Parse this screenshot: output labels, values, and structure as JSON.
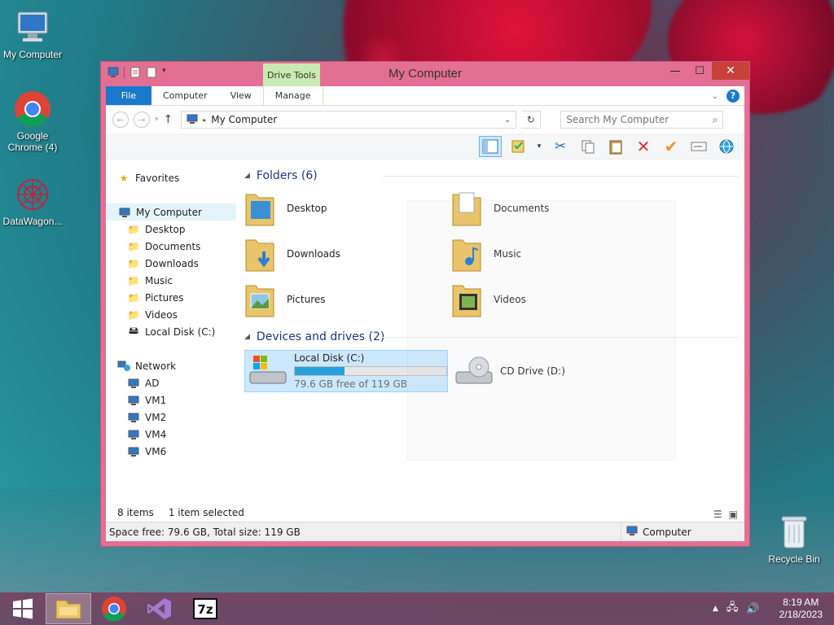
{
  "desktop": {
    "icons": [
      {
        "label": "My Computer"
      },
      {
        "label": "Google Chrome (4)"
      },
      {
        "label": "DataWagon..."
      },
      {
        "label": "Recycle Bin"
      }
    ]
  },
  "window": {
    "title": "My Computer",
    "context_tab": "Drive Tools",
    "ribbon_tabs": [
      "File",
      "Computer",
      "View",
      "Manage"
    ],
    "controls": {
      "minimize": "—",
      "maximize": "☐",
      "close": "✕"
    }
  },
  "address": {
    "path": "My Computer",
    "search_placeholder": "Search My Computer"
  },
  "navpane": {
    "favorites": "Favorites",
    "computer": "My Computer",
    "computer_children": [
      "Desktop",
      "Documents",
      "Downloads",
      "Music",
      "Pictures",
      "Videos",
      "Local Disk (C:)"
    ],
    "network": "Network",
    "network_children": [
      "AD",
      "VM1",
      "VM2",
      "VM4",
      "VM6"
    ]
  },
  "folders_group": {
    "title": "Folders (6)",
    "items": [
      "Desktop",
      "Documents",
      "Downloads",
      "Music",
      "Pictures",
      "Videos"
    ]
  },
  "drives_group": {
    "title": "Devices and drives (2)",
    "drives": [
      {
        "name": "Local Disk (C:)",
        "free_text": "79.6 GB free of 119 GB",
        "used_fraction": 0.33
      },
      {
        "name": "CD Drive (D:)"
      }
    ]
  },
  "status": {
    "items_count": "8 items",
    "selected": "1 item selected",
    "space": "Space free: 79.6 GB, Total size: 119 GB",
    "location": "Computer"
  },
  "taskbar": {
    "time": "8:19 AM",
    "date": "2/18/2023"
  },
  "colors": {
    "window_frame": "#e36f95",
    "accent_blue": "#1979ca",
    "close_red": "#c7403a",
    "drive_tools_green": "#c9eab0"
  }
}
